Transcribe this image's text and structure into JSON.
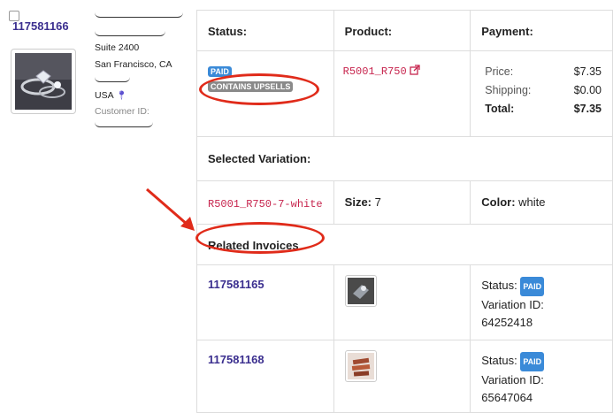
{
  "order": {
    "id": "117581166",
    "address": {
      "suite": "Suite 2400",
      "city": "San Francisco, CA",
      "country": "USA",
      "customer_id_label": "Customer ID:"
    }
  },
  "table": {
    "status_header": "Status:",
    "product_header": "Product:",
    "payment_header": "Payment:",
    "status_badges": {
      "paid": "PAID",
      "upsell": "CONTAINS UPSELLS"
    },
    "product_sku": "R5001_R750",
    "payment": {
      "price_label": "Price:",
      "price_value": "$7.35",
      "shipping_label": "Shipping:",
      "shipping_value": "$0.00",
      "total_label": "Total:",
      "total_value": "$7.35"
    },
    "selected_variation_header": "Selected Variation:",
    "variation": {
      "sku": "R5001_R750-7-white",
      "size_label": "Size:",
      "size_value": "7",
      "color_label": "Color:",
      "color_value": "white"
    },
    "related_invoices_header": "Related Invoices",
    "related_invoices": [
      {
        "id": "117581165",
        "status_label": "Status:",
        "status_badge": "PAID",
        "variation_label": "Variation ID:",
        "variation_id": "64252418"
      },
      {
        "id": "117581168",
        "status_label": "Status:",
        "status_badge": "PAID",
        "variation_label": "Variation ID:",
        "variation_id": "65647064"
      }
    ]
  },
  "colors": {
    "link": "#3b2f8f",
    "sku": "#c7254e",
    "paid_badge": "#3a8ad8",
    "upsell_badge": "#8a8a8a",
    "annotation": "#e02b1a"
  },
  "icons": {
    "external_link": "external-link-icon",
    "location": "map-pin-icon"
  }
}
